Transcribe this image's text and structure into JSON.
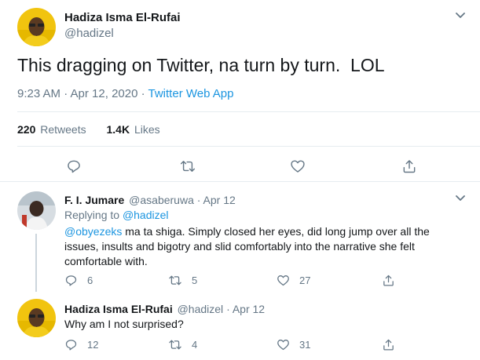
{
  "main_tweet": {
    "display_name": "Hadiza Isma El-Rufai",
    "handle": "@hadizel",
    "text": "This dragging on Twitter, na turn by turn.  LOL",
    "time": "9:23 AM · Apr 12, 2020 ·",
    "source": "Twitter Web App",
    "retweets_count": "220",
    "retweets_label": "Retweets",
    "likes_count": "1.4K",
    "likes_label": "Likes"
  },
  "replies": [
    {
      "display_name": "F. I. Jumare",
      "handle": "@asaberuwa",
      "date": "· Apr 12",
      "replying_label": "Replying to",
      "replying_to": "@hadizel",
      "mention": "@obyezeks",
      "text": " ma ta shiga. Simply closed her eyes, did long jump over all the issues, insults and bigotry and slid comfortably into the narrative she felt comfortable with.",
      "reply_count": "6",
      "retweet_count": "5",
      "like_count": "27"
    },
    {
      "display_name": "Hadiza Isma El-Rufai",
      "handle": "@hadizel",
      "date": "· Apr 12",
      "text": "Why am I not surprised?",
      "reply_count": "12",
      "retweet_count": "4",
      "like_count": "31"
    }
  ],
  "colors": {
    "text": "#14171a",
    "secondary": "#657786",
    "link": "#1b95e0",
    "divider": "#e6ecf0"
  },
  "icons": [
    "chevron-down-icon",
    "reply-icon",
    "retweet-icon",
    "like-icon",
    "share-icon"
  ]
}
